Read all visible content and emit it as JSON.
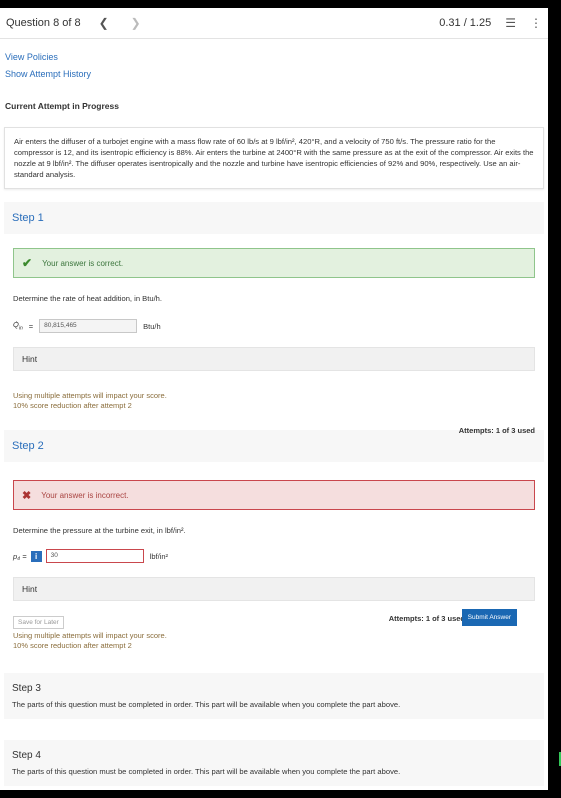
{
  "header": {
    "title": "Question 8 of 8",
    "prev_icon": "chevron-left",
    "next_icon": "chevron-right",
    "score": "0.31 / 1.25",
    "list_icon": "list",
    "more_icon": "more-vertical"
  },
  "links": {
    "policies": "View Policies",
    "history": "Show Attempt History"
  },
  "current_attempt": "Current Attempt in Progress",
  "problem": "Air enters the diffuser of a turbojet engine with a mass flow rate of 60 lb/s at 9 lbf/in², 420°R, and a velocity of 750 ft/s. The pressure ratio for the compressor is 12, and its isentropic efficiency is 88%. Air enters the turbine at 2400°R with the same pressure as at the exit of the compressor. Air exits the nozzle at 9 lbf/in². The diffuser operates isentropically and the nozzle and turbine have isentropic efficiencies of 92% and 90%, respectively. Use an air-standard analysis.",
  "step1": {
    "title": "Step 1",
    "feedback": "Your answer is correct.",
    "prompt": "Determine the rate of heat addition, in Btu/h.",
    "var_label": "Q̇",
    "var_sub": "in",
    "eq": "=",
    "value": "80,815,465",
    "unit": "Btu/h",
    "hint": "Hint",
    "attempts": "Attempts: 1 of 3 used",
    "note1": "Using multiple attempts will impact your score.",
    "note2": "10% score reduction after attempt 2"
  },
  "step2": {
    "title": "Step 2",
    "feedback": "Your answer is incorrect.",
    "prompt": "Determine the pressure at the turbine exit, in lbf/in².",
    "var_label": "p₄ =",
    "info": "i",
    "value": "30",
    "unit": "lbf/in²",
    "hint": "Hint",
    "save": "Save for Later",
    "attempts": "Attempts: 1 of 3 used",
    "submit": "Submit Answer",
    "note1": "Using multiple attempts will impact your score.",
    "note2": "10% score reduction after attempt 2"
  },
  "step3": {
    "title": "Step 3",
    "desc": "The parts of this question must be completed in order. This part will be available when you complete the part above."
  },
  "step4": {
    "title": "Step 4",
    "desc": "The parts of this question must be completed in order. This part will be available when you complete the part above."
  }
}
